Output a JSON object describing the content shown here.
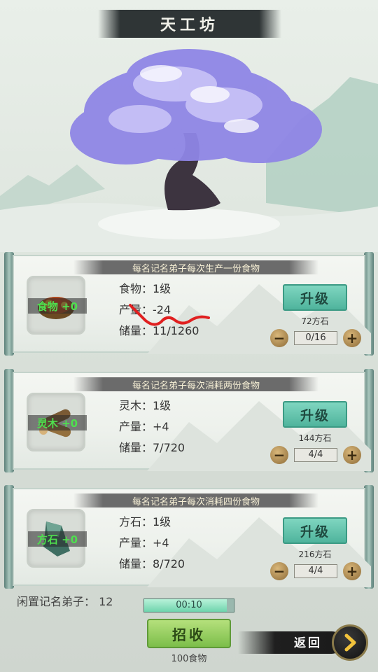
{
  "header": {
    "title": "天工坊"
  },
  "panels": [
    {
      "desc": "每名记名弟子每次生产一份食物",
      "icon_name": "food-icon",
      "icon_label": "食物 +0",
      "level": "食物：1级",
      "output": "产量：-24",
      "storage": "储量：11/1260",
      "upgrade_label": "升级",
      "cost": "72方石",
      "assigned": "0/16"
    },
    {
      "desc": "每名记名弟子每次消耗两份食物",
      "icon_name": "wood-log-icon",
      "icon_label": "灵木 +0",
      "level": "灵木：1级",
      "output": "产量：+4",
      "storage": "储量：7/720",
      "upgrade_label": "升级",
      "cost": "144方石",
      "assigned": "4/4"
    },
    {
      "desc": "每名记名弟子每次消耗四份食物",
      "icon_name": "stone-icon",
      "icon_label": "方石 +0",
      "level": "方石：1级",
      "output": "产量：+4",
      "storage": "储量：8/720",
      "upgrade_label": "升级",
      "cost": "216方石",
      "assigned": "4/4"
    }
  ],
  "footer": {
    "idle_disciples": "闲置记名弟子：  12",
    "timer": "00:10",
    "timer_progress": 0.92,
    "recruit_label": "招收",
    "recruit_cost": "100食物",
    "back_label": "返回"
  },
  "colors": {
    "accent_teal": "#4fb49c",
    "recruit_green": "#7cbe4a",
    "icon_label_green": "#4ee04e",
    "annotation_red": "#e02020"
  }
}
